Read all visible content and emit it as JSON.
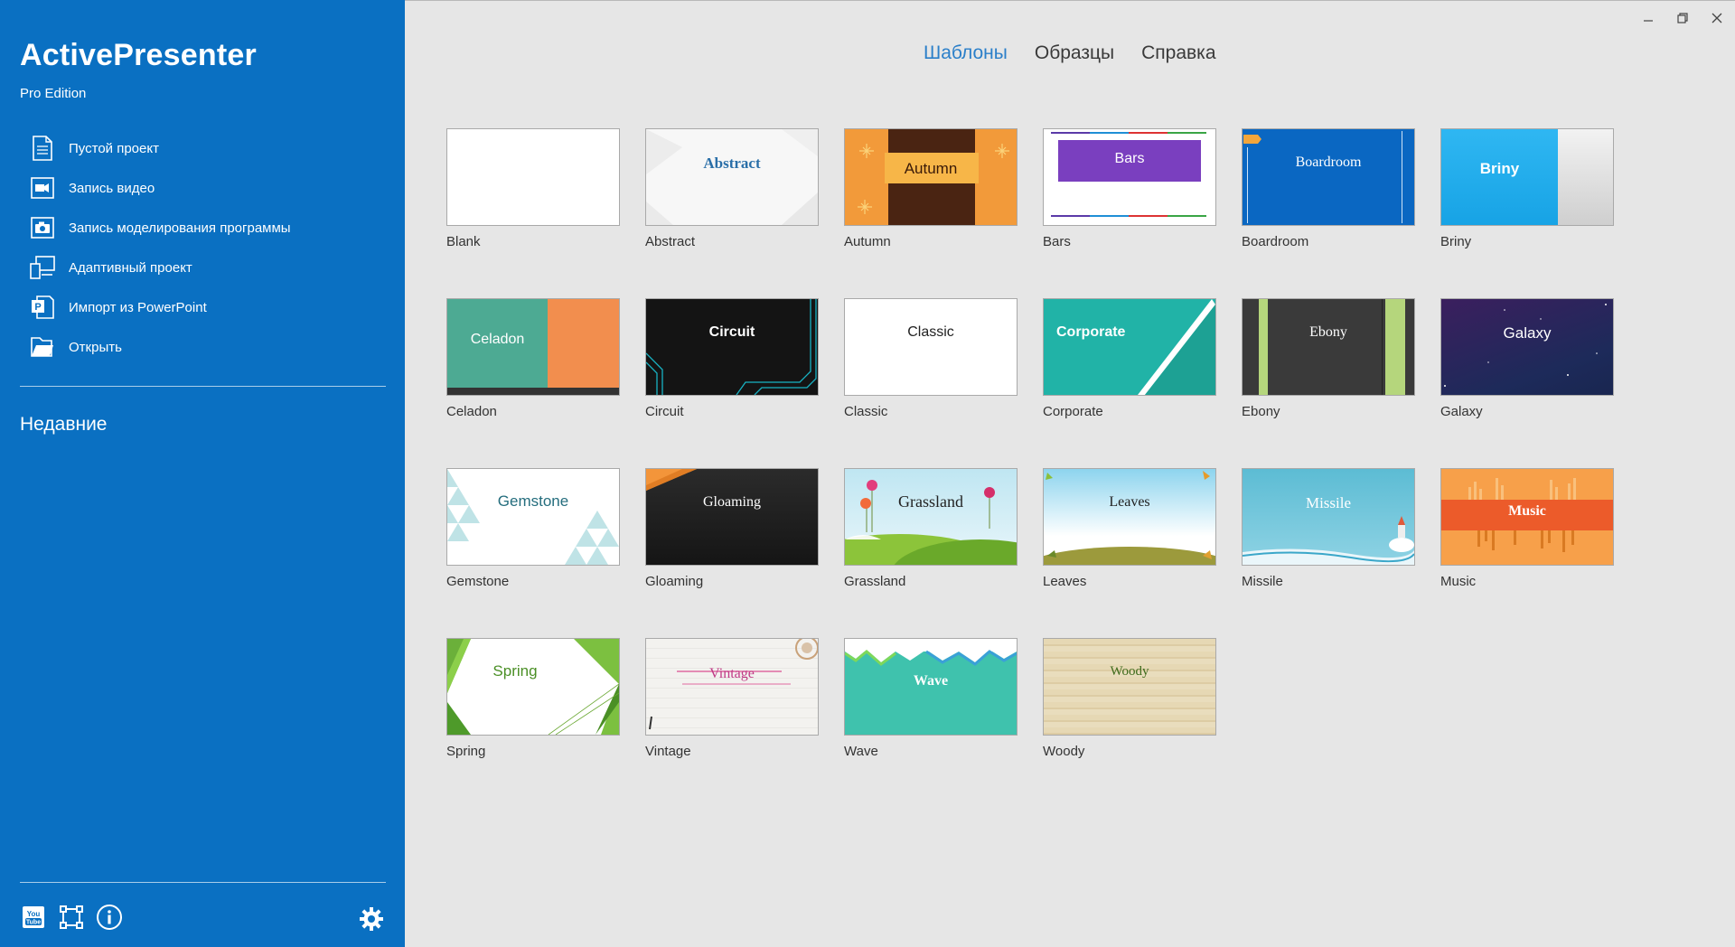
{
  "sidebar": {
    "app_title": "ActivePresenter",
    "edition": "Pro Edition",
    "menu": [
      {
        "label": "Пустой проект",
        "icon": "blank-document-icon"
      },
      {
        "label": "Запись видео",
        "icon": "video-camera-icon"
      },
      {
        "label": "Запись моделирования программы",
        "icon": "photo-camera-icon"
      },
      {
        "label": "Адаптивный проект",
        "icon": "responsive-devices-icon"
      },
      {
        "label": "Импорт из PowerPoint",
        "icon": "powerpoint-icon"
      },
      {
        "label": "Открыть",
        "icon": "open-folder-icon"
      }
    ],
    "recent_label": "Недавние",
    "bottom_icons": [
      "youtube-icon",
      "crop-frame-icon",
      "info-icon"
    ],
    "settings_icon": "gear-icon"
  },
  "tabs": [
    {
      "label": "Шаблоны",
      "active": true
    },
    {
      "label": "Образцы",
      "active": false
    },
    {
      "label": "Справка",
      "active": false
    }
  ],
  "window_controls": [
    "minimize-icon",
    "restore-icon",
    "close-icon"
  ],
  "templates": [
    {
      "name": "Blank",
      "thumb_text": ""
    },
    {
      "name": "Abstract",
      "thumb_text": "Abstract"
    },
    {
      "name": "Autumn",
      "thumb_text": "Autumn"
    },
    {
      "name": "Bars",
      "thumb_text": "Bars"
    },
    {
      "name": "Boardroom",
      "thumb_text": "Boardroom"
    },
    {
      "name": "Briny",
      "thumb_text": "Briny"
    },
    {
      "name": "Celadon",
      "thumb_text": "Celadon"
    },
    {
      "name": "Circuit",
      "thumb_text": "Circuit"
    },
    {
      "name": "Classic",
      "thumb_text": "Classic"
    },
    {
      "name": "Corporate",
      "thumb_text": "Corporate"
    },
    {
      "name": "Ebony",
      "thumb_text": "Ebony"
    },
    {
      "name": "Galaxy",
      "thumb_text": "Galaxy"
    },
    {
      "name": "Gemstone",
      "thumb_text": "Gemstone"
    },
    {
      "name": "Gloaming",
      "thumb_text": "Gloaming"
    },
    {
      "name": "Grassland",
      "thumb_text": "Grassland"
    },
    {
      "name": "Leaves",
      "thumb_text": "Leaves"
    },
    {
      "name": "Missile",
      "thumb_text": "Missile"
    },
    {
      "name": "Music",
      "thumb_text": "Music"
    },
    {
      "name": "Spring",
      "thumb_text": "Spring"
    },
    {
      "name": "Vintage",
      "thumb_text": "Vintage"
    },
    {
      "name": "Wave",
      "thumb_text": "Wave"
    },
    {
      "name": "Woody",
      "thumb_text": "Woody"
    }
  ],
  "colors": {
    "sidebar": "#0a70c2",
    "accent_tab": "#2b7fc9",
    "background": "#e6e6e6"
  }
}
